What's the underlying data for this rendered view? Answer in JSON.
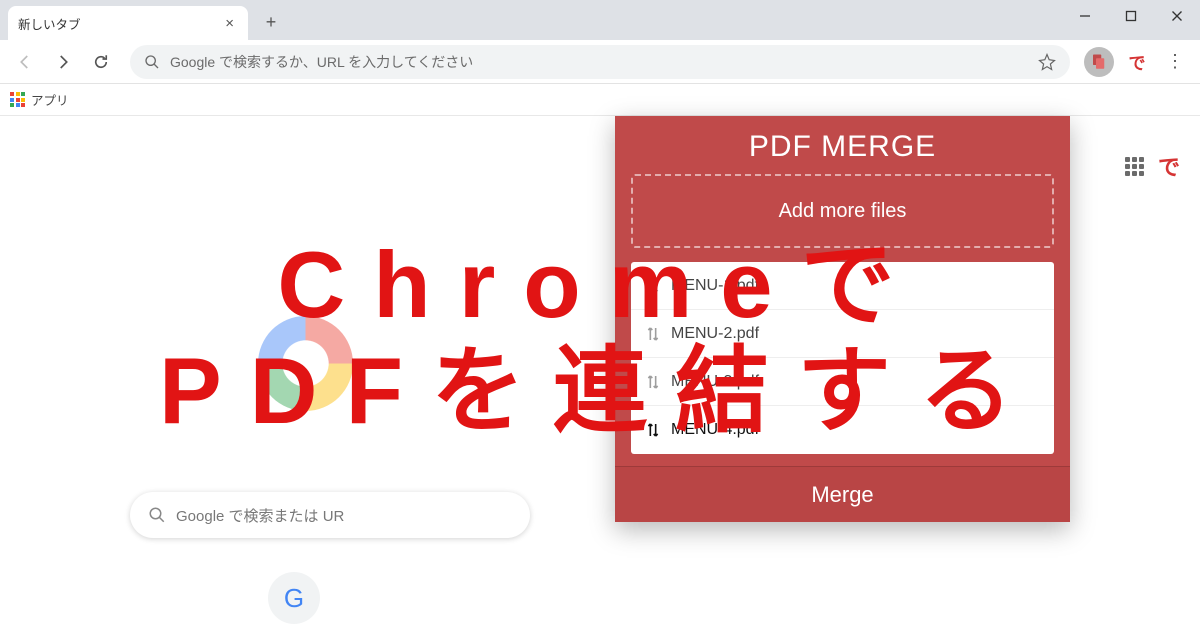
{
  "tab": {
    "title": "新しいタブ"
  },
  "toolbar": {
    "omnibox_placeholder": "Google で検索するか、URL を入力してください"
  },
  "bookmarks": {
    "apps_label": "アプリ"
  },
  "content": {
    "search_placeholder": "Google で検索または UR"
  },
  "popup": {
    "title": "PDF MERGE",
    "dropzone_label": "Add more files",
    "files": [
      {
        "name": "MENU-1.pdf"
      },
      {
        "name": "MENU-2.pdf"
      },
      {
        "name": "MENU-3.pdf"
      },
      {
        "name": "MENU-4.pdf"
      }
    ],
    "merge_button": "Merge"
  },
  "overlay": {
    "line1": "Chromeで",
    "line2": "PDFを連結する"
  }
}
